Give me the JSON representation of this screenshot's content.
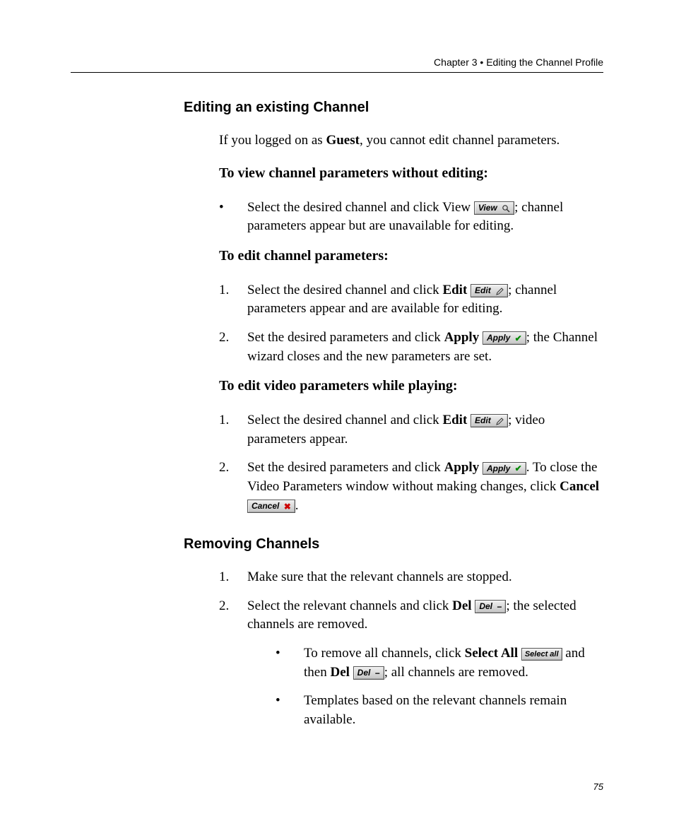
{
  "header": {
    "chapter": "Chapter 3",
    "separator": "•",
    "title": "Editing the Channel Profile"
  },
  "section1": {
    "heading": "Editing an existing Channel",
    "intro_prefix": "If you logged on as ",
    "intro_bold": "Guest",
    "intro_suffix": ", you cannot edit channel parameters.",
    "sub1": {
      "heading": "To view channel parameters without editing:",
      "item1_a": "Select the desired channel and click View ",
      "item1_b": "; channel parameters appear but are unavailable for editing."
    },
    "sub2": {
      "heading": "To edit channel parameters:",
      "item1_a": "Select the desired channel and click ",
      "item1_bold": "Edit",
      "item1_b": "; channel parameters appear and are available for editing.",
      "item2_a": "Set the desired parameters and click ",
      "item2_bold": "Apply",
      "item2_b": "; the Channel wizard closes and the new parameters are set."
    },
    "sub3": {
      "heading": "To edit video parameters while playing:",
      "item1_a": "Select the desired channel and click ",
      "item1_bold": "Edit",
      "item1_b": "; video parameters appear.",
      "item2_a": "Set the desired parameters and click ",
      "item2_bold": "Apply",
      "item2_b": ". To close the Video Parameters window without making changes, click ",
      "item2_bold2": "Cancel",
      "item2_c": "."
    }
  },
  "section2": {
    "heading": "Removing Channels",
    "item1": "Make sure that the relevant channels are stopped.",
    "item2_a": "Select the relevant channels and click ",
    "item2_bold": "Del",
    "item2_b": "; the selected channels are removed.",
    "sub_item1_a": "To remove all channels, click ",
    "sub_item1_bold1": "Select All",
    "sub_item1_b": " and then ",
    "sub_item1_bold2": "Del",
    "sub_item1_c": "; all channels are removed.",
    "sub_item2": "Templates based on the relevant channels remain available."
  },
  "buttons": {
    "view": "View",
    "edit": "Edit",
    "apply": "Apply",
    "cancel": "Cancel",
    "del": "Del",
    "select_all": "Select all"
  },
  "markers": {
    "bullet": "•",
    "n1": "1.",
    "n2": "2."
  },
  "page_number": "75"
}
